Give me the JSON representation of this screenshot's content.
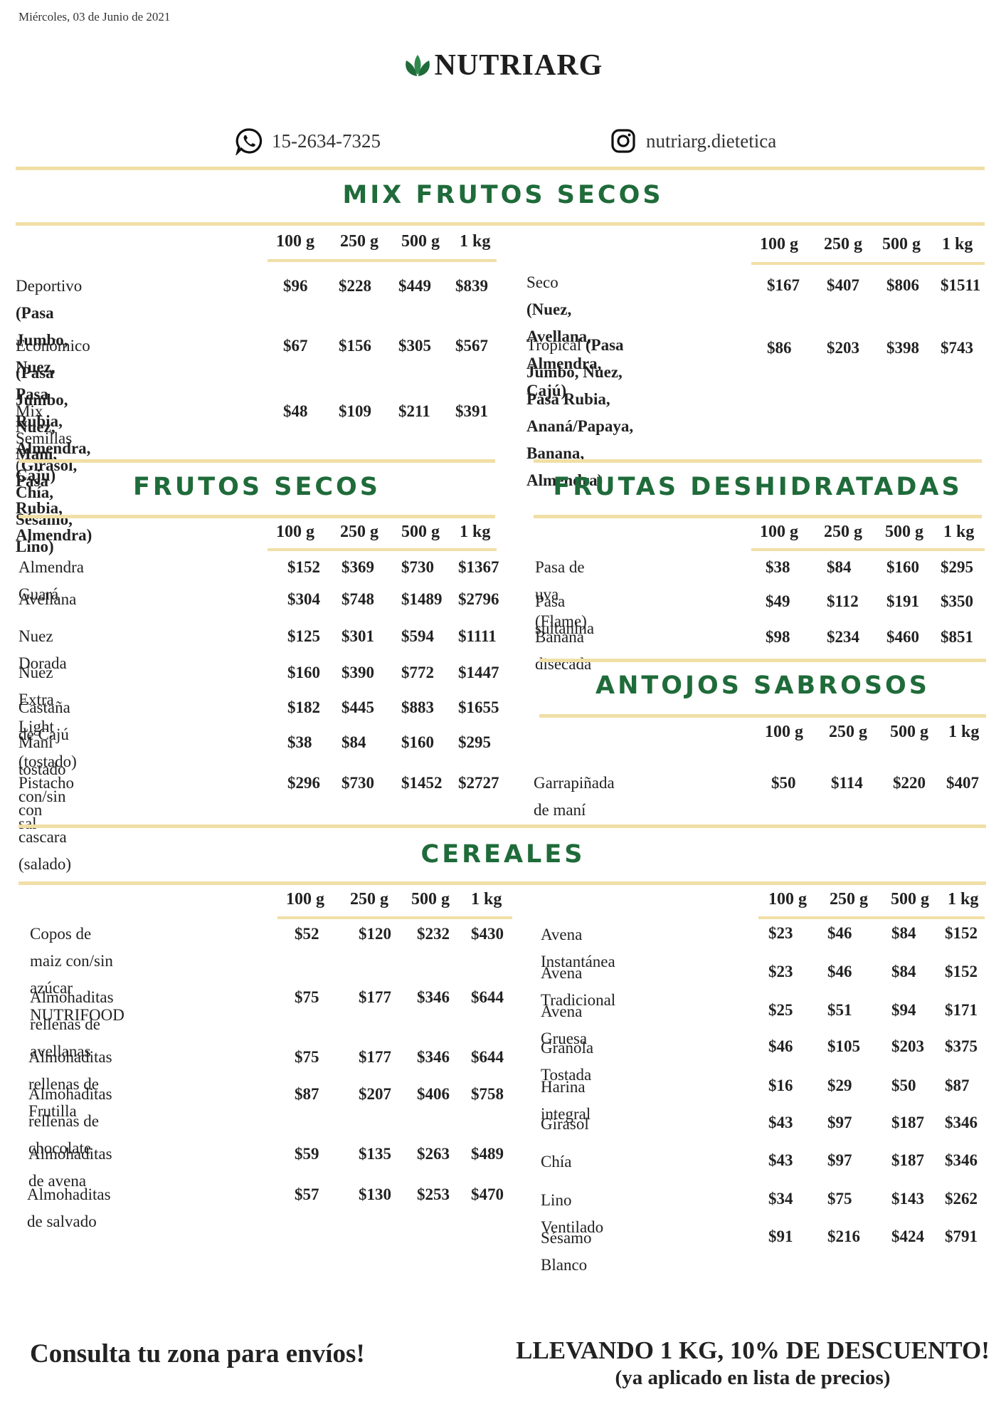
{
  "date": "Miércoles, 03 de Junio de 2021",
  "brand": "NUTRIARG",
  "contact": {
    "phone": "15-2634-7325",
    "instagram": "nutriarg.dietetica"
  },
  "headers": [
    "100 g",
    "250 g",
    "500 g",
    "1 kg"
  ],
  "mix": {
    "title": "MIX FRUTOS SECOS",
    "left": [
      {
        "name": "Deportivo ",
        "detail": "(Pasa Jumbo, Nuez,",
        "name2": "",
        "detail2": "Pasa Rubia, Almendra, Caju)",
        "prices": [
          "$96",
          "$228",
          "$449",
          "$839"
        ]
      },
      {
        "name": "Económico ",
        "detail": "(Pasa Jumbo, Nuez,",
        "name2": "",
        "detail2": "Maní, Pasa Rubia, Almendra)",
        "prices": [
          "$67",
          "$156",
          "$305",
          "$567"
        ]
      },
      {
        "name": "Mix Semillas (",
        "detail": "Girasol, Chía,",
        "name2": "",
        "detail2": "Sésamo, Lino)",
        "prices": [
          "$48",
          "$109",
          "$211",
          "$391"
        ]
      }
    ],
    "right": [
      {
        "name": "Seco ",
        "detail": "(Nuez, Avellana,",
        "detail2": "Almendra, Cajú)",
        "detail3": "",
        "prices": [
          "$167",
          "$407",
          "$806",
          "$1511"
        ]
      },
      {
        "name": "Tropical ",
        "detail": "(Pasa Jumbo, Nuez,",
        "detail2": "Pasa Rubia, Ananá/Papaya,",
        "detail3": "Banana, Almendra)",
        "prices": [
          "$86",
          "$203",
          "$398",
          "$743"
        ]
      }
    ]
  },
  "frutos": {
    "title": "FRUTOS SECOS",
    "items": [
      {
        "name": "Almendra Guará",
        "prices": [
          "$152",
          "$369",
          "$730",
          "$1367"
        ]
      },
      {
        "name": "Avellana",
        "prices": [
          "$304",
          "$748",
          "$1489",
          "$2796"
        ]
      },
      {
        "name": "Nuez Dorada",
        "prices": [
          "$125",
          "$301",
          "$594",
          "$1111"
        ]
      },
      {
        "name": "Nuez Extra Light",
        "prices": [
          "$160",
          "$390",
          "$772",
          "$1447"
        ]
      },
      {
        "name": "Castaña de Cajú (tostado)",
        "prices": [
          "$182",
          "$445",
          "$883",
          "$1655"
        ]
      },
      {
        "name": "Maní tostado con/sin sal",
        "prices": [
          "$38",
          "$84",
          "$160",
          "$295"
        ]
      },
      {
        "name": "Pistacho con cascara (salado)",
        "prices": [
          "$296",
          "$730",
          "$1452",
          "$2727"
        ]
      }
    ]
  },
  "frutas": {
    "title": "FRUTAS DESHIDRATADAS",
    "items": [
      {
        "name": "Pasa de uva (Flame)",
        "prices": [
          "$38",
          "$84",
          "$160",
          "$295"
        ]
      },
      {
        "name": "Pasa sultanina",
        "prices": [
          "$49",
          "$112",
          "$191",
          "$350"
        ]
      },
      {
        "name": "Banana disecada",
        "prices": [
          "$98",
          "$234",
          "$460",
          "$851"
        ]
      }
    ]
  },
  "antojos": {
    "title": "ANTOJOS SABROSOS",
    "items": [
      {
        "name": "Garrapiñada de maní",
        "prices": [
          "$50",
          "$114",
          "$220",
          "$407"
        ]
      }
    ]
  },
  "cereales": {
    "title": "CEREALES",
    "left": [
      {
        "name": "Copos de maiz con/sin azúcar",
        "name2": "NUTRIFOOD",
        "prices": [
          "$52",
          "$120",
          "$232",
          "$430"
        ]
      },
      {
        "name": "Almohaditas rellenas de",
        "name2": "avellanas",
        "prices": [
          "$75",
          "$177",
          "$346",
          "$644"
        ]
      },
      {
        "name": "Almohaditas rellenas de Frutilla",
        "name2": "",
        "prices": [
          "$75",
          "$177",
          "$346",
          "$644"
        ]
      },
      {
        "name": "Almohaditas rellenas de",
        "name2": "chocolate",
        "prices": [
          "$87",
          "$207",
          "$406",
          "$758"
        ]
      },
      {
        "name": "Almohaditas de avena",
        "name2": "",
        "prices": [
          "$59",
          "$135",
          "$263",
          "$489"
        ]
      },
      {
        "name": "Almohaditas de salvado",
        "name2": "",
        "prices": [
          "$57",
          "$130",
          "$253",
          "$470"
        ]
      }
    ],
    "right": [
      {
        "name": "Avena Instantánea",
        "prices": [
          "$23",
          "$46",
          "$84",
          "$152"
        ]
      },
      {
        "name": "Avena Tradicional",
        "prices": [
          "$23",
          "$46",
          "$84",
          "$152"
        ]
      },
      {
        "name": "Avena Gruesa",
        "prices": [
          "$25",
          "$51",
          "$94",
          "$171"
        ]
      },
      {
        "name": "Granola Tostada",
        "prices": [
          "$46",
          "$105",
          "$203",
          "$375"
        ]
      },
      {
        "name": "Harina integral",
        "prices": [
          "$16",
          "$29",
          "$50",
          "$87"
        ]
      },
      {
        "name": "Girasol",
        "prices": [
          "$43",
          "$97",
          "$187",
          "$346"
        ]
      },
      {
        "name": "Chía",
        "prices": [
          "$43",
          "$97",
          "$187",
          "$346"
        ]
      },
      {
        "name": "Lino Ventilado",
        "prices": [
          "$34",
          "$75",
          "$143",
          "$262"
        ]
      },
      {
        "name": "Sésamo Blanco",
        "prices": [
          "$91",
          "$216",
          "$424",
          "$791"
        ]
      }
    ]
  },
  "footer": {
    "left": "Consulta tu zona para envíos!",
    "right_line1": "LLEVANDO 1 KG, 10% DE DESCUENTO!",
    "right_line2": "(ya aplicado en lista de precios)"
  },
  "colors": {
    "accent": "#1f6b3a",
    "rule": "#f1dfa6",
    "text": "#222222"
  }
}
